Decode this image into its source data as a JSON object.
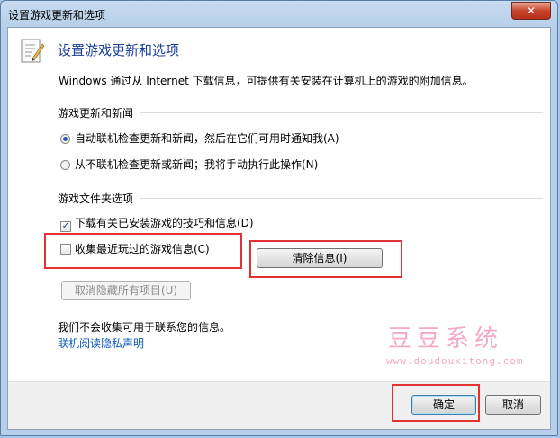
{
  "window": {
    "title": "设置游戏更新和选项",
    "close_label": "✕"
  },
  "header": {
    "title": "设置游戏更新和选项",
    "icon": "checklist-pencil-icon"
  },
  "description": "Windows 通过从 Internet 下载信息，可提供有关安装在计算机上的游戏的附加信息。",
  "update_section": {
    "label": "游戏更新和新闻",
    "options": [
      {
        "label": "自动联机检查更新和新闻，然后在它们可用时通知我(A)",
        "checked": true
      },
      {
        "label": "从不联机检查更新或新闻；我将手动执行此操作(N)",
        "checked": false
      }
    ]
  },
  "folder_section": {
    "label": "游戏文件夹选项",
    "download_tips": {
      "label": "下载有关已安装游戏的技巧和信息(D)",
      "checked": true
    },
    "collect_recent": {
      "label": "收集最近玩过的游戏信息(C)",
      "checked": false
    },
    "clear_button": "清除信息(I)",
    "unhide_button": "取消隐藏所有项目(U)"
  },
  "privacy": {
    "notice": "我们不会收集可用于联系您的信息。",
    "link": "联机阅读隐私声明"
  },
  "watermark": {
    "name": "豆豆系统",
    "url": "www.doudouxitong.com"
  },
  "footer": {
    "ok_label": "确定",
    "cancel_label": "取消"
  },
  "colors": {
    "highlight_box": "#e53131",
    "header_title": "#1b3f9a",
    "link": "#0b58b8"
  }
}
